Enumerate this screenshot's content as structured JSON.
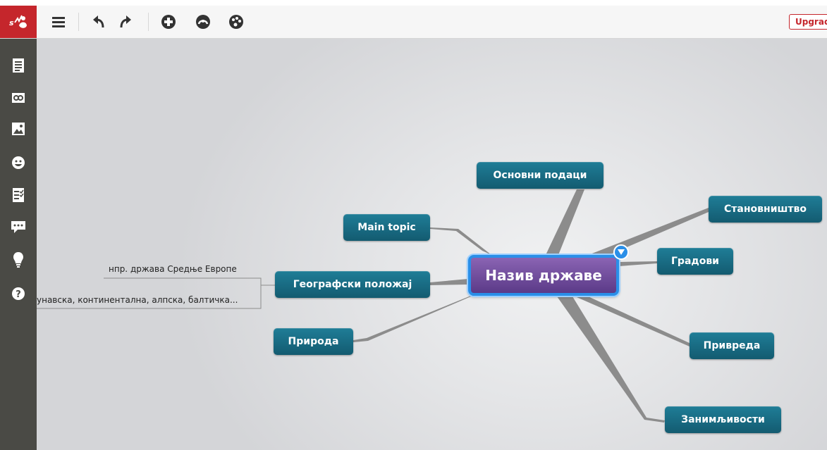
{
  "toolbar": {
    "upgrade_label": "Upgrad"
  },
  "mindmap": {
    "central": "Назив државе",
    "nodes": {
      "osnovni": "Основни подаци",
      "main_topic": "Main topic",
      "geo": "Географски положај",
      "priroda": "Природа",
      "stanovnistvo": "Становништво",
      "gradovi": "Градови",
      "privreda": "Привреда",
      "zanimljivosti": "Занимљивости"
    },
    "notes": {
      "note1": "нпр. држава Средње Европе",
      "note2": "унавска, континентална, алпска, балтичка..."
    }
  },
  "colors": {
    "brand": "#c5262c",
    "node": "#1a6e87",
    "central": "#6b4a99",
    "selection": "#2a8fe8",
    "sidebar": "#4a4a45"
  },
  "icons": {
    "toolbar": [
      "menu-icon",
      "undo-icon",
      "redo-icon",
      "add-icon",
      "style-icon",
      "palette-icon"
    ],
    "sidebar": [
      "notes-icon",
      "link-icon",
      "image-icon",
      "emoji-icon",
      "task-icon",
      "comment-icon",
      "idea-icon",
      "help-icon"
    ]
  }
}
